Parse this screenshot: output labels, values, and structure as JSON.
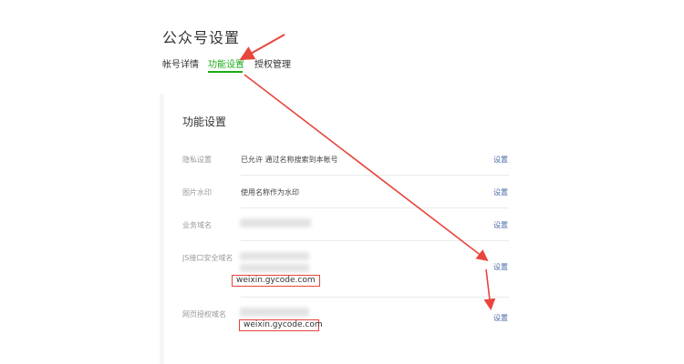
{
  "page": {
    "title": "公众号设置"
  },
  "tabs": [
    {
      "label": "帐号详情",
      "active": false
    },
    {
      "label": "功能设置",
      "active": true
    },
    {
      "label": "授权管理",
      "active": false
    }
  ],
  "section": {
    "title": "功能设置"
  },
  "rows": [
    {
      "label": "隐私设置",
      "value": "已允许 通过名称搜索到本帐号",
      "action": "设置"
    },
    {
      "label": "图片水印",
      "value": "使用名称作为水印",
      "action": "设置"
    },
    {
      "label": "业务域名",
      "value": "",
      "action": "设置"
    },
    {
      "label": "JS接口安全域名",
      "value": "weixin.gycode.com",
      "action": "设置"
    },
    {
      "label": "网页授权域名",
      "value": "weixin.gycode.com",
      "action": "设置"
    }
  ],
  "colors": {
    "accent": "#1aad19",
    "annotation": "#e8453c",
    "link": "#4a6aa5"
  }
}
